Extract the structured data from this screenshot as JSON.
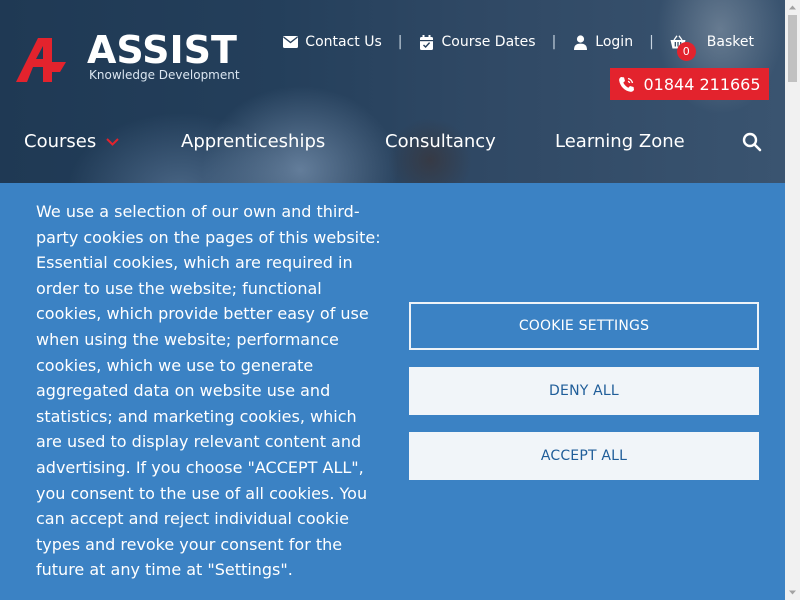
{
  "brand": {
    "name": "ASSIST",
    "tagline": "Knowledge Development",
    "accent": "#e3232d"
  },
  "util_nav": {
    "contact": "Contact Us",
    "course_dates": "Course Dates",
    "login": "Login",
    "basket": "Basket",
    "basket_count": "0",
    "separator": "|"
  },
  "phone": {
    "number": "01844 211665"
  },
  "main_nav": {
    "courses": "Courses",
    "apprenticeships": "Apprenticeships",
    "consultancy": "Consultancy",
    "learning_zone": "Learning Zone"
  },
  "cookie_banner": {
    "text": "We use a selection of our own and third-party cookies on the pages of this website: Essential cookies, which are required in order to use the website; functional cookies, which provide better easy of use when using the website; performance cookies, which we use to generate aggregated data on website use and statistics; and marketing cookies, which are used to display relevant content and advertising. If you choose \"ACCEPT ALL\", you consent to the use of all cookies. You can accept and reject individual cookie types and revoke your consent for the future at any time at \"Settings\".",
    "settings_label": "COOKIE SETTINGS",
    "deny_label": "DENY ALL",
    "accept_label": "ACCEPT ALL",
    "background": "#3b82c4"
  },
  "icons": {
    "contact": "envelope-icon",
    "course_dates": "calendar-icon",
    "login": "user-icon",
    "basket": "basket-icon",
    "phone": "phone-icon",
    "search": "search-icon",
    "courses_dropdown": "chevron-down-icon"
  }
}
